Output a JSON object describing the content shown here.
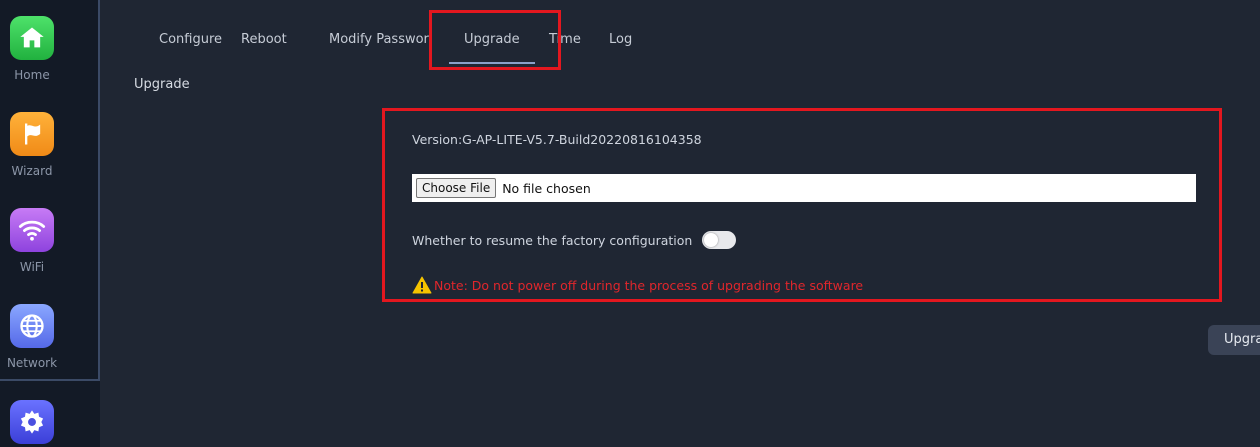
{
  "sidebar": {
    "items": [
      {
        "label": "Home",
        "icon": "home-icon"
      },
      {
        "label": "Wizard",
        "icon": "flag-icon"
      },
      {
        "label": "WiFi",
        "icon": "wifi-icon"
      },
      {
        "label": "Network",
        "icon": "globe-icon"
      },
      {
        "label": "",
        "icon": "gear-icon"
      }
    ]
  },
  "tabs": [
    {
      "label": "Configure"
    },
    {
      "label": "Reboot"
    },
    {
      "label": "Modify Password"
    },
    {
      "label": "Upgrade",
      "active": true
    },
    {
      "label": "Time"
    },
    {
      "label": "Log"
    }
  ],
  "main": {
    "section_title": "Upgrade",
    "version": "Version:G-AP-LITE-V5.7-Build20220816104358",
    "file_input": {
      "button_label": "Choose File",
      "status": "No file chosen"
    },
    "factory_label": "Whether to resume the factory configuration",
    "factory_toggle_on": false,
    "note": "Note: Do not power off during the process of upgrading the software",
    "upgrade_button": "Upgrade"
  },
  "colors": {
    "highlight": "#e3171f",
    "note": "#e0262c",
    "warning": "#f5c400"
  }
}
